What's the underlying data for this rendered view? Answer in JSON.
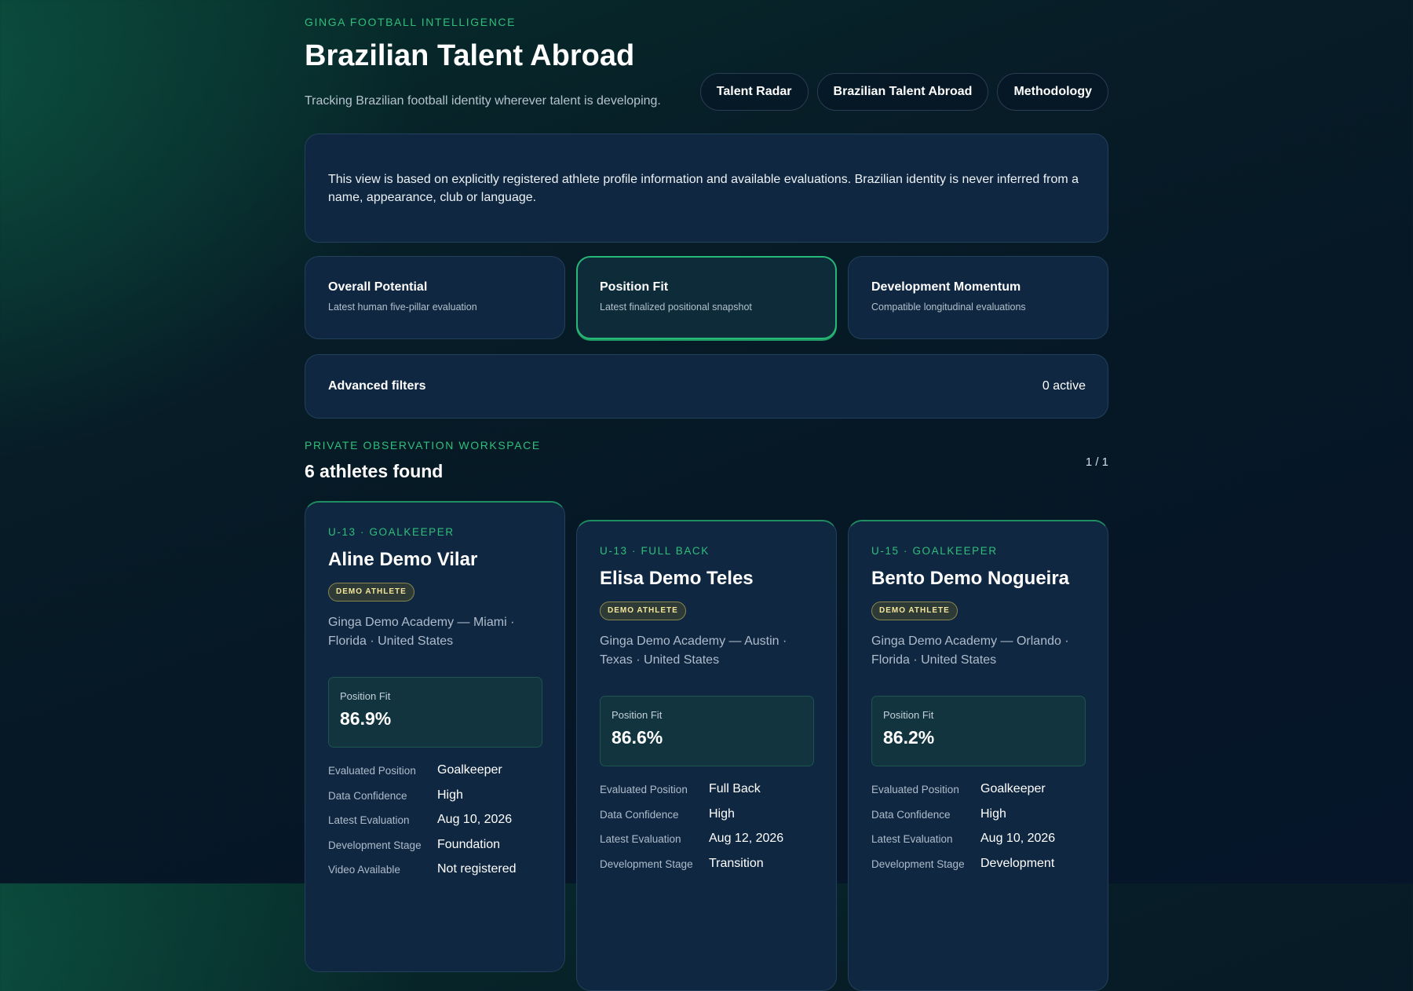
{
  "header": {
    "eyebrow": "GINGA FOOTBALL INTELLIGENCE",
    "title": "Brazilian Talent Abroad",
    "subtitle": "Tracking Brazilian football identity wherever talent is developing."
  },
  "nav": [
    {
      "label": "Talent Radar"
    },
    {
      "label": "Brazilian Talent Abroad"
    },
    {
      "label": "Methodology"
    }
  ],
  "notice": {
    "text": "This view is based on explicitly registered athlete profile information and available evaluations. Brazilian identity is never inferred from a name, appearance, club or language."
  },
  "modes": [
    {
      "title": "Overall Potential",
      "desc": "Latest human five-pillar evaluation",
      "active": false
    },
    {
      "title": "Position Fit",
      "desc": "Latest finalized positional snapshot",
      "active": true
    },
    {
      "title": "Development Momentum",
      "desc": "Compatible longitudinal evaluations",
      "active": false
    }
  ],
  "filters": {
    "label": "Advanced filters",
    "count": "0 active"
  },
  "workspace": {
    "eyebrow": "PRIVATE OBSERVATION WORKSPACE",
    "results": "6 athletes found",
    "pager": "1 / 1"
  },
  "cards": [
    {
      "eyebrow": "U-13 · GOALKEEPER",
      "name": "Aline Demo Vilar",
      "badge": "DEMO ATHLETE",
      "club": "Ginga Demo Academy — Miami · Florida · United States",
      "fit_label": "Position Fit",
      "fit_value": "86.9%",
      "rows": [
        {
          "label": "Evaluated Position",
          "value": "Goalkeeper"
        },
        {
          "label": "Data Confidence",
          "value": "High"
        },
        {
          "label": "Latest Evaluation",
          "value": "Aug 10, 2026"
        },
        {
          "label": "Development Stage",
          "value": "Foundation"
        },
        {
          "label": "Video Available",
          "value": "Not registered"
        }
      ]
    },
    {
      "eyebrow": "U-13 · FULL BACK",
      "name": "Elisa Demo Teles",
      "badge": "DEMO ATHLETE",
      "club": "Ginga Demo Academy — Austin · Texas · United States",
      "fit_label": "Position Fit",
      "fit_value": "86.6%",
      "rows": [
        {
          "label": "Evaluated Position",
          "value": "Full Back"
        },
        {
          "label": "Data Confidence",
          "value": "High"
        },
        {
          "label": "Latest Evaluation",
          "value": "Aug 12, 2026"
        },
        {
          "label": "Development Stage",
          "value": "Transition"
        }
      ]
    },
    {
      "eyebrow": "U-15 · GOALKEEPER",
      "name": "Bento Demo Nogueira",
      "badge": "DEMO ATHLETE",
      "club": "Ginga Demo Academy — Orlando · Florida · United States",
      "fit_label": "Position Fit",
      "fit_value": "86.2%",
      "rows": [
        {
          "label": "Evaluated Position",
          "value": "Goalkeeper"
        },
        {
          "label": "Data Confidence",
          "value": "High"
        },
        {
          "label": "Latest Evaluation",
          "value": "Aug 10, 2026"
        },
        {
          "label": "Development Stage",
          "value": "Development"
        }
      ]
    }
  ],
  "colors": {
    "accent": "#2fbf7a",
    "panel": "#0f2740",
    "badge_text": "#f4e59a"
  }
}
